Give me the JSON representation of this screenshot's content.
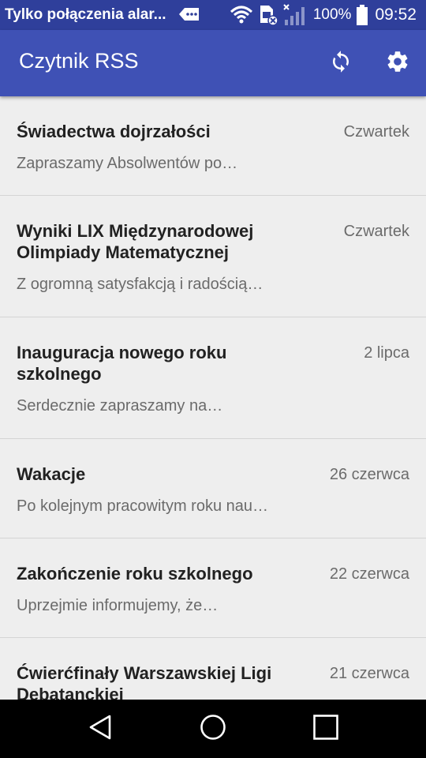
{
  "status_bar": {
    "carrier_text": "Tylko połączenia alar...",
    "battery_percent": "100%",
    "time": "09:52",
    "icons": [
      "message-icon",
      "wifi-icon",
      "sim-disabled-icon",
      "signal-icon",
      "battery-icon"
    ]
  },
  "app_bar": {
    "title": "Czytnik RSS",
    "actions": [
      "refresh-icon",
      "settings-icon"
    ]
  },
  "feed": {
    "items": [
      {
        "title": "Świadectwa dojrzałości",
        "date": "Czwartek",
        "desc": "Zapraszamy Absolwentów po…"
      },
      {
        "title": "Wyniki LIX Międzynarodowej Olimpiady Matematycznej",
        "date": "Czwartek",
        "desc": "Z ogromną satysfakcją i radością…"
      },
      {
        "title": "Inauguracja nowego roku szkolnego",
        "date": "2 lipca",
        "desc": "Serdecznie zapraszamy na…"
      },
      {
        "title": "Wakacje",
        "date": "26 czerwca",
        "desc": "Po kolejnym pracowitym roku nau…"
      },
      {
        "title": "Zakończenie roku szkolnego",
        "date": "22 czerwca",
        "desc": "Uprzejmie informujemy, że…"
      },
      {
        "title": "Ćwierćfinały Warszawskiej Ligi Debatanckiej",
        "date": "21 czerwca",
        "desc": ""
      }
    ]
  },
  "nav_bar": {
    "buttons": [
      "back-icon",
      "home-icon",
      "recents-icon"
    ]
  },
  "colors": {
    "status_bar": "#2f3f9b",
    "app_bar": "#3f51b5",
    "list_background": "#eeeeee",
    "title_text": "#212121",
    "secondary_text": "#6b6b6b"
  }
}
